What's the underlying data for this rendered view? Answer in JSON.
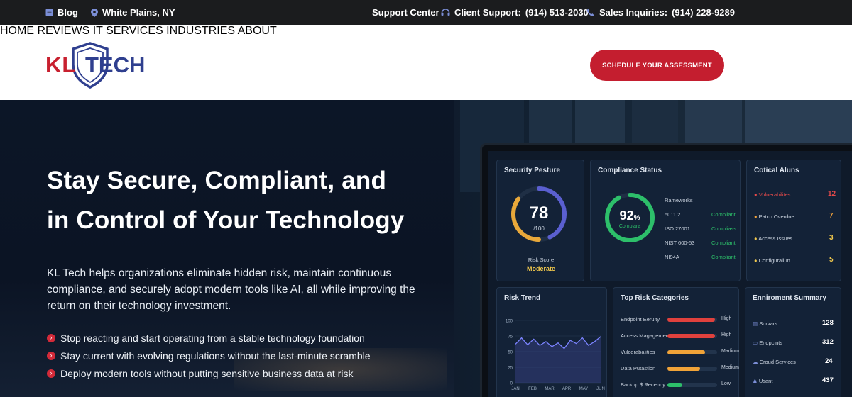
{
  "topbar": {
    "blog": "Blog",
    "location": "White Plains, NY",
    "support_center": "Support Center",
    "client_support_label": "Client Support:",
    "client_support_phone": "(914) 513-2030",
    "sales_label": "Sales Inquiries:",
    "sales_phone": "(914) 228-9289"
  },
  "logo": {
    "left": "KL",
    "right": "TECH"
  },
  "nav": {
    "items": [
      "HOME",
      "REVIEWS",
      "IT SERVICES",
      "INDUSTRIES",
      "ABOUT"
    ],
    "cta": "SCHEDULE YOUR ASSESSMENT"
  },
  "hero": {
    "title_line1": "Stay Secure, Compliant, and",
    "title_line2": "in Control of Your Technology",
    "description": "KL Tech helps organizations eliminate hidden risk, maintain continuous compliance, and securely adopt modern tools like AI, all while improving the return on their technology investment.",
    "bullets": [
      "Stop reacting and start operating from a stable technology foundation",
      "Stay current with evolving regulations without the last-minute scramble",
      "Deploy modern tools without putting sensitive business data at risk"
    ]
  },
  "dashboard": {
    "security": {
      "title": "Security Pesture",
      "score": "78",
      "out_of": "/100",
      "risk_label": "Risk Score",
      "risk_value": "Moderate",
      "score_fraction": 0.78
    },
    "compliance": {
      "title": "Compliance Status",
      "percent": "92",
      "percent_sign": "%",
      "caption": "Complara",
      "percent_fraction": 0.92,
      "frameworks_label": "Rameworks",
      "rows": [
        {
          "name": "5011 2",
          "status": "Compliant"
        },
        {
          "name": "ISO 27001",
          "status": "Compliass"
        },
        {
          "name": "NIST 600-53",
          "status": "Compliant"
        },
        {
          "name": "NI94A",
          "status": "Compliant"
        }
      ]
    },
    "alerts": {
      "title": "Cotical Aluns",
      "rows": [
        {
          "name": "Vulnerabilites",
          "value": "12"
        },
        {
          "name": "Patch Overdne",
          "value": "7"
        },
        {
          "name": "Access Issues",
          "value": "3"
        },
        {
          "name": "Configuraliun",
          "value": "5"
        }
      ]
    },
    "risk_trend": {
      "title": "Risk Trend",
      "y_ticks": [
        "100",
        "75",
        "50",
        "25",
        "0"
      ],
      "x_ticks": [
        "JAN",
        "FEB",
        "MAR",
        "APR",
        "MAY",
        "JUN"
      ],
      "values": [
        62,
        72,
        61,
        70,
        60,
        66,
        58,
        64,
        55,
        68,
        63,
        72,
        60,
        66,
        74
      ]
    },
    "risk_categories": {
      "title": "Top Risk Categories",
      "rows": [
        {
          "name": "Endpoint Eeruity",
          "level": "High",
          "fraction": 0.95,
          "color": "#e0413d"
        },
        {
          "name": "Access Magagement",
          "level": "High",
          "fraction": 0.95,
          "color": "#e0413d"
        },
        {
          "name": "Vulcerabalities",
          "level": "Madium",
          "fraction": 0.75,
          "color": "#f0a338"
        },
        {
          "name": "Data Putastion",
          "level": "Medium",
          "fraction": 0.65,
          "color": "#f0a338"
        },
        {
          "name": "Backup $ Recenny",
          "level": "Low",
          "fraction": 0.3,
          "color": "#2dbf6a"
        }
      ]
    },
    "environment": {
      "title": "Enniroment Summary",
      "rows": [
        {
          "name": "Sorvars",
          "value": "128"
        },
        {
          "name": "Endpcints",
          "value": "312"
        },
        {
          "name": "Croud Services",
          "value": "24"
        },
        {
          "name": "Usant",
          "value": "437"
        }
      ]
    }
  }
}
